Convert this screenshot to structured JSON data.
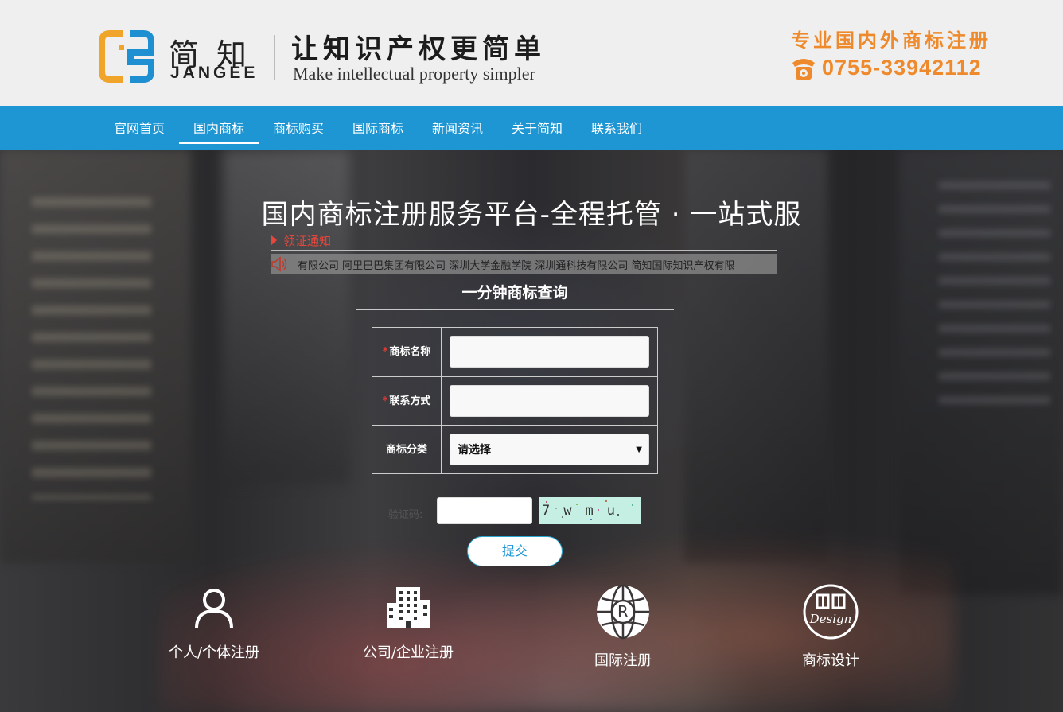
{
  "header": {
    "logo_cn": "简知",
    "logo_en": "JANGEE",
    "slogan_cn": "让知识产权更简单",
    "slogan_en": "Make intellectual property simpler",
    "promo": "专业国内外商标注册",
    "phone": "0755-33942112"
  },
  "nav": {
    "items": [
      "官网首页",
      "国内商标",
      "商标购买",
      "国际商标",
      "新闻资讯",
      "关于简知",
      "联系我们"
    ],
    "active_index": 1
  },
  "hero": {
    "title": "国内商标注册服务平台-全程托管 · 一站式服",
    "notice_label": "领证通知",
    "ticker": "有限公司 阿里巴巴集团有限公司 深圳大学金融学院 深圳通科技有限公司    简知国际知识产权有限"
  },
  "form": {
    "title": "一分钟商标查询",
    "fields": [
      {
        "label": "商标名称",
        "required": true,
        "value": ""
      },
      {
        "label": "联系方式",
        "required": true,
        "value": ""
      }
    ],
    "category_label": "商标分类",
    "category_value": "请选择",
    "captcha_label": "验证码:",
    "captcha_text": "7wmu",
    "submit_label": "提交"
  },
  "features": [
    {
      "label": "个人/个体注册",
      "icon": "person-icon"
    },
    {
      "label": "公司/企业注册",
      "icon": "building-icon"
    },
    {
      "label": "国际注册",
      "icon": "globe-registered-icon"
    },
    {
      "label": "商标设计",
      "icon": "design-seal-icon"
    }
  ],
  "colors": {
    "nav_bg": "#1e96d4",
    "accent_orange": "#ef8a2c",
    "notice_red": "#e6473c"
  }
}
